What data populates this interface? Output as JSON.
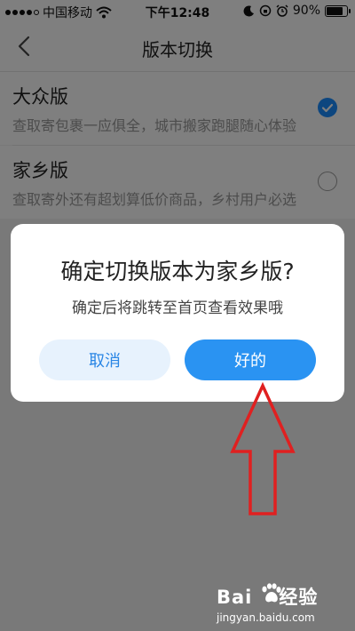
{
  "status_bar": {
    "carrier": "中国移动",
    "time": "下午12:48",
    "battery": "90%",
    "battery_level": 0.9
  },
  "nav": {
    "title": "版本切换"
  },
  "options": [
    {
      "title": "大众版",
      "desc": "查取寄包裹一应俱全，城市搬家跑腿随心体验",
      "selected": true
    },
    {
      "title": "家乡版",
      "desc": "查取寄外还有超划算低价商品，乡村用户必选",
      "selected": false
    }
  ],
  "dialog": {
    "title": "确定切换版本为家乡版?",
    "message": "确定后将跳转至首页查看效果哦",
    "cancel_label": "取消",
    "ok_label": "好的"
  },
  "watermark": {
    "brand": "Bai",
    "brand_suffix": "经验",
    "url": "jingyan.baidu.com"
  },
  "colors": {
    "accent": "#2a93f2",
    "cancel_bg": "#e7f2fd",
    "annotation_arrow": "#e02020"
  }
}
